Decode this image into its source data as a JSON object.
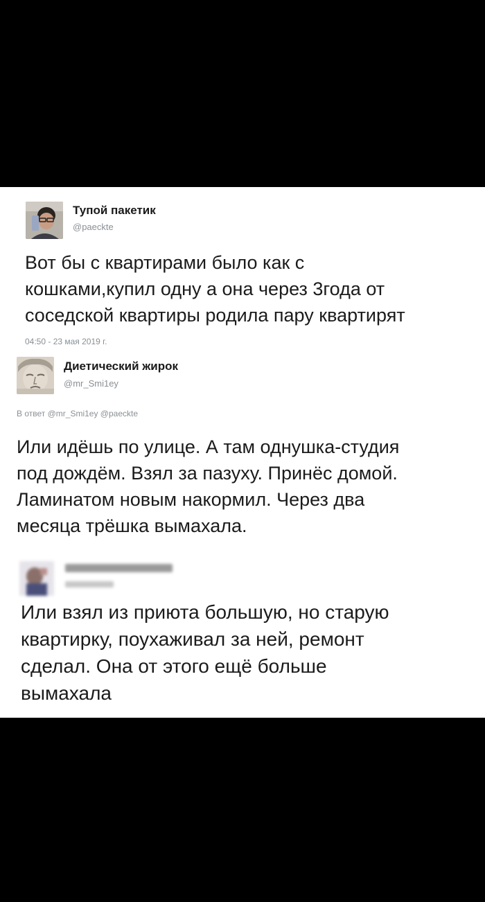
{
  "tweets": [
    {
      "name": "Тупой пакетик",
      "handle": "@paeckte",
      "lines": [
        "Вот бы с квартирами было как с",
        "кошками,купил одну а она через 3года от",
        "соседской квартиры родила пару квартирят"
      ],
      "timestamp": "04:50 - 23 мая 2019 г."
    },
    {
      "name": "Диетический жирок",
      "handle": "@mr_Smi1ey",
      "reply_to": "В ответ @mr_Smi1ey @paeckte",
      "lines": [
        "Или идёшь по улице. А там однушка-студия",
        "под дождём. Взял за пазуху. Принёс домой.",
        "Ламинатом новым накормил. Через два",
        "месяца трёшка вымахала."
      ]
    },
    {
      "lines": [
        "Или взял из приюта большую, но старую",
        "квартирку, поухаживал за ней, ремонт",
        "сделал. Она от этого ещё больше",
        "вымахала"
      ]
    }
  ]
}
